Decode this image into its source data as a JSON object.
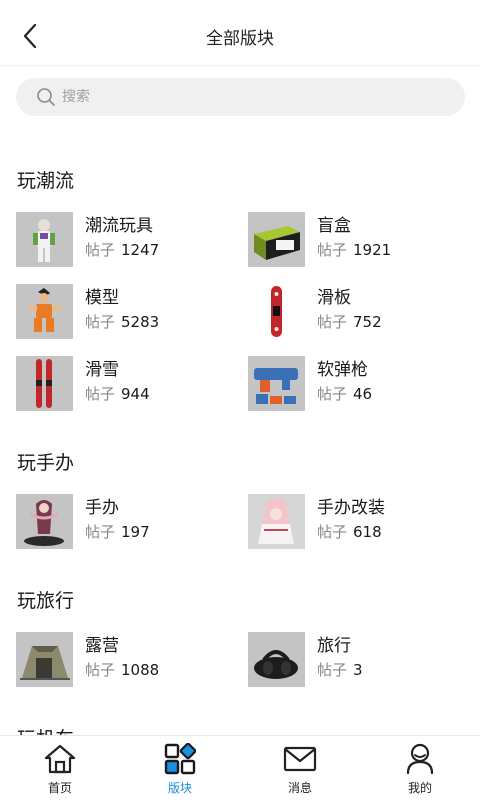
{
  "header": {
    "title": "全部版块",
    "back_icon": "chevron-left-icon"
  },
  "search": {
    "placeholder": "搜索",
    "icon": "search-icon"
  },
  "count_label": "帖子",
  "sections": [
    {
      "title": "玩潮流",
      "items": [
        {
          "name": "潮流玩具",
          "count": "1247",
          "thumb": "toy-figure-image"
        },
        {
          "name": "盲盒",
          "count": "1921",
          "thumb": "blind-box-image"
        },
        {
          "name": "模型",
          "count": "5283",
          "thumb": "model-figure-image"
        },
        {
          "name": "滑板",
          "count": "752",
          "thumb": "skateboard-image"
        },
        {
          "name": "滑雪",
          "count": "944",
          "thumb": "skis-image"
        },
        {
          "name": "软弹枪",
          "count": "46",
          "thumb": "foam-blaster-image"
        }
      ]
    },
    {
      "title": "玩手办",
      "items": [
        {
          "name": "手办",
          "count": "197",
          "thumb": "figure-statue-image"
        },
        {
          "name": "手办改装",
          "count": "618",
          "thumb": "custom-figure-image"
        }
      ]
    },
    {
      "title": "玩旅行",
      "items": [
        {
          "name": "露营",
          "count": "1088",
          "thumb": "tent-image"
        },
        {
          "name": "旅行",
          "count": "3",
          "thumb": "travel-bag-image"
        }
      ]
    },
    {
      "title": "玩机车",
      "items": []
    }
  ],
  "tabbar": {
    "active": "版块",
    "accent_color": "#1a8fe0",
    "tabs": [
      {
        "label": "首页",
        "icon": "home-icon"
      },
      {
        "label": "版块",
        "icon": "grid-icon"
      },
      {
        "label": "消息",
        "icon": "mail-icon"
      },
      {
        "label": "我的",
        "icon": "user-icon"
      }
    ]
  }
}
